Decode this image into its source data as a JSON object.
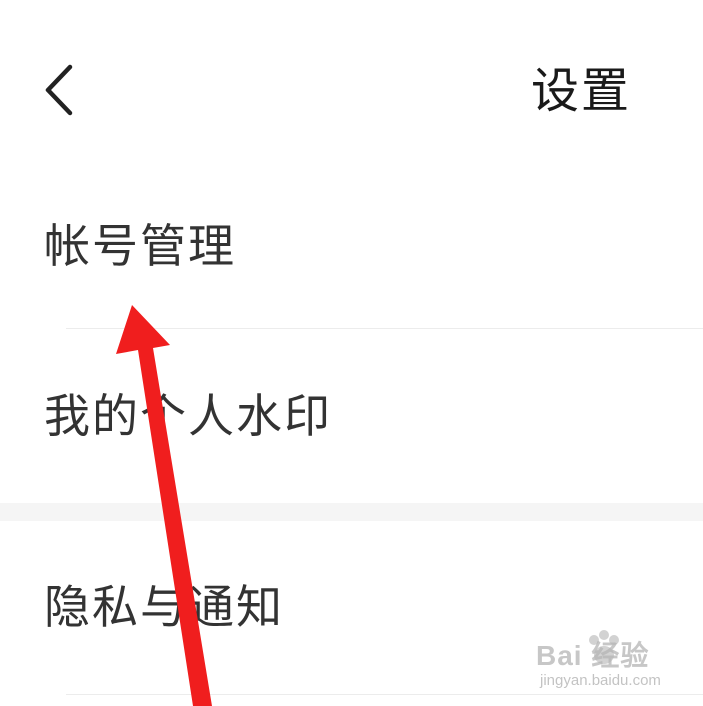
{
  "header": {
    "title": "设置",
    "back_icon": "chevron-left-icon"
  },
  "menu": {
    "items": [
      {
        "label": "帐号管理"
      },
      {
        "label": "我的个人水印"
      },
      {
        "label": "隐私与通知"
      }
    ]
  },
  "annotation": {
    "arrow_color": "#f01e1e"
  },
  "watermark": {
    "brand": "Bai  经验",
    "url": "jingyan.baidu.com"
  },
  "colors": {
    "background": "#ffffff",
    "text": "#333333",
    "title": "#1a1a1a",
    "divider": "#ececec",
    "section_gap": "#f5f5f5"
  }
}
